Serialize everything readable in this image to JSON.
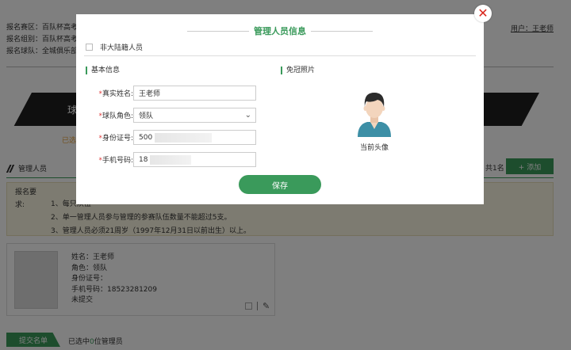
{
  "background": {
    "info_lines": [
      "报名赛区：百队杯高考",
      "报名组别：百队杯高考",
      "报名球队：全城俱乐部"
    ],
    "user_link": "用户：王老师",
    "banner_text": "球",
    "status_text": "已选",
    "count_text": "共1名",
    "add_button": "+ 添加",
    "section_title": "管理人员",
    "requirements": {
      "label_line1": "报名要",
      "label_line2": "求:",
      "items": [
        "1、每只队伍",
        "2、单一管理人员参与管理的参赛队伍数量不能超过5支。",
        "3、管理人员必须21周岁（1997年12月31日以前出生）以上。"
      ]
    },
    "card": {
      "name": "姓名：王老师",
      "role": "角色：领队",
      "id": "身份证号：",
      "phone": "手机号码：18523281209",
      "status": "未提交"
    },
    "submit_tab": "提交名单",
    "submit_info_prefix": "已选中",
    "submit_info_count": "0",
    "submit_info_suffix": "位管理员"
  },
  "modal": {
    "title": "管理人员信息",
    "non_mainland_label": "非大陆籍人员",
    "section_basic": "基本信息",
    "section_photo": "免冠照片",
    "fields": {
      "name_label": "真实姓名:",
      "name_value": "王老师",
      "role_label": "球队角色:",
      "role_value": "领队",
      "id_label": "身份证号:",
      "id_value": "500",
      "phone_label": "手机号码:",
      "phone_value": "18"
    },
    "required_mark": "*",
    "avatar_caption": "当前头像",
    "save_button": "保存",
    "close_icon": "close-icon"
  },
  "colors": {
    "accent": "#3a9a5b",
    "close": "#d9261c",
    "required": "#e03c3c",
    "warning_bg": "#fbf6e2"
  }
}
